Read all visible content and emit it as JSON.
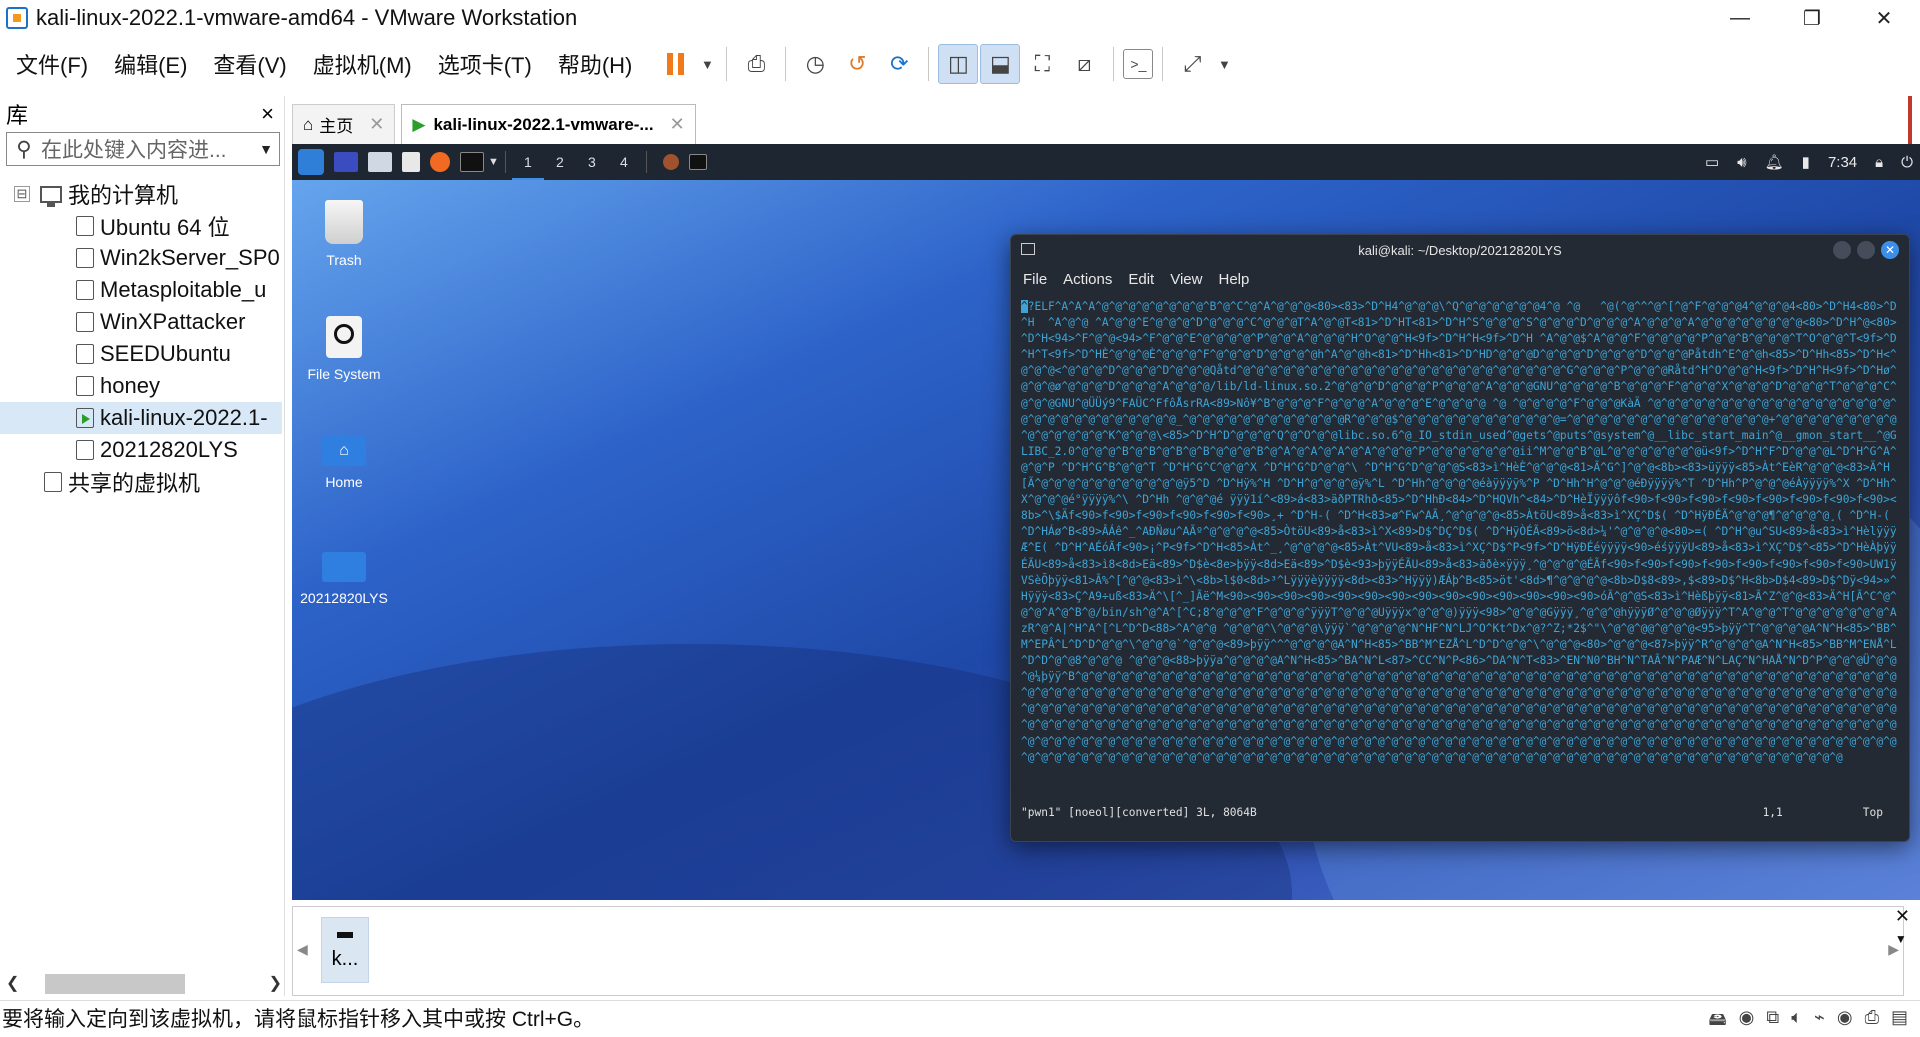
{
  "window": {
    "title": "kali-linux-2022.1-vmware-amd64 - VMware Workstation",
    "minimize": "—",
    "maximize": "❐",
    "close": "✕"
  },
  "menus": [
    "文件(F)",
    "编辑(E)",
    "查看(V)",
    "虚拟机(M)",
    "选项卡(T)",
    "帮助(H)"
  ],
  "library": {
    "title": "库",
    "close": "×",
    "search_placeholder": "在此处键入内容进...",
    "root": "我的计算机",
    "root_toggle": "⊟",
    "vms": [
      "Ubuntu 64 位",
      "Win2kServer_SP0",
      "Metasploitable_u",
      "WinXPattacker",
      "SEEDUbuntu",
      "honey",
      "kali-linux-2022.1-",
      "20212820LYS"
    ],
    "selected_vm": "kali-linux-2022.1-",
    "shared": "共享的虚拟机"
  },
  "tabs": [
    {
      "label": "主页",
      "close": "✕"
    },
    {
      "label": "kali-linux-2022.1-vmware-...",
      "close": "✕"
    }
  ],
  "guest": {
    "workspaces": [
      "1",
      "2",
      "3",
      "4"
    ],
    "active_workspace": "1",
    "clock": "7:34",
    "desktop_icons": [
      "Trash",
      "File System",
      "Home",
      "20212820LYS"
    ]
  },
  "terminal": {
    "title": "kali@kali: ~/Desktop/20212820LYS",
    "menu": [
      "File",
      "Actions",
      "Edit",
      "View",
      "Help"
    ],
    "cursor_char": "^",
    "content": "?ELF^A^A^A^@^@^@^@^@^@^@^@^B^@^C^@^A^@^@^@<80><83>^D^H4^@^@^@\\^Q^@^@^@^@^@^@4^@ ^@   ^@(^@^^^@^[^@^F^@^@^@4^@^@^@4<80>^D^H4<80>^D^H  ^A^@^@ ^A^@^@^E^@^@^@^D^@^@^@^C^@^@^@T^A^@^@T<81>^D^HT<81>^D^H^S^@^@^@^S^@^@^@^D^@^@^@^A^@^@^@^A^@^@^@^@^@^@^@^@<80>^D^H^@<80>^D^H<94>^F^@^@<94>^F^@^@^E^@^@^@^@^P^@^@^A^@^@^@^H^O^@^@^H<9f>^D^H^H<9f>^D^H ^A^@^@$^A^@^@^F^@^@^@^@^P^@^@^B^@^@^@^T^O^@^@^T<9f>^D^H^T<9f>^D^HÈ^@^@^@È^@^@^@^F^@^@^@^D^@^@^@^@h^A^@^@h<81>^D^Hh<81>^D^HD^@^@^@D^@^@^@^D^@^@^@^D^@^@^@Påtdh^E^@^@h<85>^D^Hh<85>^D^H<^@^@^@<^@^@^@^D^@^@^@^D^@^@^@Qåtd^@^@^@^@^@^@^@^@^@^@^@^@^@^@^@^@^@^@^@^@^@^@^@^@^G^@^@^@^P^@^@^@Råtd^H^O^@^@^H<9f>^D^H^H<9f>^D^Hø^@^@^@ø^@^@^@^D^@^@^@^A^@^@^@/lib/ld-linux.so.2^@^@^@^D^@^@^@^P^@^@^@^A^@^@^@GNU^@^@^@^@^B^@^@^@^F^@^@^@^X^@^@^@^D^@^@^@^T^@^@^@^C^@^@^@GNU^@ÜÜý9^FAÜC^FfôÅsrRA<89>Nô¥^B^@^@^@^F^@^@^@^A^@^@^@^E^@^@^@^@ ^@ ^@^@^@^@^F^@^@^@KàÄ ^@^@^@^@^@^@^@^@^@^@^@^@^@^@^@^@^@^@^@^@^@^@^@^@^@^@^@^@^@^@_^@^@^@^@^@^@^@^@^@^@^@^@R^@^@^@$^@^@^@^@^@^@^@^@^@^@^@^@=^@^@^@^@^@^@^@^@^@^@^@^@^@^@^@+^@^@^@^@^@^@^@^@^@^@^@^@^@^@^@^K^@^@^@\\<85>^D^H^D^@^@^@^Q^@^O^@^@libc.so.6^@_IO_stdin_used^@gets^@puts^@system^@__libc_start_main^@__gmon_start__^@GLIBC_2.0^@^@^@^B^@^B^@^B^@^B^@^@^@^B^@^A^@^A^@^A^@^A^@^@^@^P^@^@^@^@^@^@^@ii^M^@^@^B^@L^@^@^@^@^@^@^@ü<9f>^D^H^F^D^@^@^@L^D^H^G^A^@^@^P ^D^H^G^B^@^@^T ^D^H^G^C^@^@^X ^D^H^G^D^@^@^\\ ^D^H^G^D^@^@^@S<83>ì^HèÈ^@^@^@<81>Ã^G^]^@^@<8b><83>üÿÿÿ<85>Àt^EèR^@^@^@<83>Ä^H[Ã^@^@^@^@^@^@^@^@^@^@^@ÿ5^D ^D^Hÿ%^H ^D^H^@^@^@^@ÿ%^L ^D^Hh^@^@^@^@éàÿÿÿÿ%^P ^D^Hh^H^@^@^@éÐÿÿÿÿ%^T ^D^Hh^P^@^@^@éÀÿÿÿÿ%^X ^D^Hh^X^@^@^@é°ÿÿÿÿ%^\\ ^D^Hh ^@^@^@é ÿÿÿ1í^<89>á<83>äðPTRhð<85>^D^HhÐ<84>^D^HQVh^<84>^D^HèÏÿÿÿôf<90>f<90>f<90>f<90>f<90>f<90>f<90>f<90><8b>^\\$Äf<90>f<90>f<90>f<90>f<90>f<90>¸+ ^D^H-( ^D^H<83>ø^Fw^AÃ¸^@^@^@^@<85>ÀtöU<89>å<83>ì^XÇ^D$( ^D^HÿÐÉÃ^@^@^@¶^@^@^@^@¸( ^D^H-( ^D^HÁø^B<89>ÂÁê^_^AÐÑøu^AÃº^@^@^@^@<85>ÒtöU<89>å<83>ì^X<89>D$^DÇ^D$( ^D^HÿÒÉÃ<89>ö<8d>¼'^@^@^@^@<80>=( ^D^H^@u^SU<89>å<83>ì^HèlÿÿÿÆ^E( ^D^H^AÉóÃf<90>¡^P<9f>^D^H<85>Àt^_¸^@^@^@^@<85>Àt^VU<89>å<83>ì^XÇ^D$^P<9f>^D^HÿÐÉéÿÿÿÿ<90>éśÿÿÿU<89>å<83>ì^XÇ^D$^<85>^D^HèÀþÿÿÉÃU<89>å<83>ì8<8d>Eä<89>^D$è<8e>þÿÿ<8d>Eä<89>^D$è<93>þÿÿÉÃU<89>å<83>äðè×ÿÿÿ¸^@^@^@^@ÉÃf<90>f<90>f<90>f<90>f<90>f<90>f<90>f<90>UW1ÿVSèÕþÿÿ<81>Ã%^[^@^@<83>ì^\\<8b>l$0<8d>³^Lÿÿÿèÿÿÿÿ<8d><83>^Hÿÿÿ)ÆÁþ^B<85>öt'<8d>¶^@^@^@^@<8b>D$8<89>,$<89>D$^H<8b>D$4<89>D$^Dÿ<94>»^Hÿÿÿ<83>Ç^A9÷uß<83>Ä^\\[^_]Ãë^M<90><90><90><90><90><90><90><90><90><90><90><90><90><90>óÃ^@^@S<83>ì^Hèßþÿÿ<81>Ã^Z^@^@<83>Ä^H[Ã^C^@^@^@^A^@^B^@/bin/sh^@^A^[^C;8^@^@^@^F^@^@^@^ÿÿÿT^@^@^@Uÿÿÿx^@^@^@)ÿÿÿ<98>^@^@^@Gÿÿÿ¸^@^@^@hÿÿÿØ^@^@^@Øÿÿÿ^T^A^@^@^T^@^@^@^@^@^@^@^AzR^@^A|^H^A^[^L^D^D<88>^A^@^@ ^@^@^@^\\^@^@^@\\ÿÿÿ`^@^@^@^@^N^HF^N^LJ^O^Kt^Dx^@?^Z;*2$^\"\\^@^@^@@^@^@^@<95>þÿÿ^T^@^@^@^@A^N^H<85>^BB^M^EPÂ^L^D^D^@^@^\\^@^@^@`^@^@^@<89>þÿÿ^^^@^@^@^@A^N^H<85>^BB^M^EZÅ^L^D^D^@^@^\\^@^@^@<80>^@^@^@<87>þÿÿ^R^@^@^@^@A^N^H<85>^BB^M^ENÅ^L^D^D^@^@8^@^@^@ ^@^@^@<88>þÿÿa^@^@^@^@A^N^H<85>^BA^N^L<87>^CC^N^P<86>^DA^N^T<83>^EN^N0^BH^N^TAÃ^N^PAÆ^N^LAÇ^N^HAÅ^N^D^P^@^@^@Ü^@^@^@¼þÿÿ^B^@^@^@^@^@^@^@^@^@^@^@^@^@^@^@^@^@^@^@^@^@^@^@^@^@^@^@^@^@^@^@^@^@^@^@^@^@^@^@^@^@^@^@^@^@^@^@^@^@^@^@^@^@^@^@^@^@^@^@^@^@^@^@^@^@^@^@^@^@^@^@^@^@^@^@^@^@^@^@^@^@^@^@^@^@^@^@^@^@^@^@^@^@^@^@^@^@^@^@^@^@^@^@^@^@^@^@^@^@^@^@^@^@^@^@^@^@^@^@^@^@^@^@^@^@^@^@^@^@^@^@^@^@^@^@^@^@^@^@^@^@^@^@^@^@^@^@^@^@^@^@^@^@^@^@^@^@^@^@^@^@^@^@^@^@^@^@^@^@^@^@^@^@^@^@^@^@^@^@^@^@^@^@^@^@^@^@^@^@^@^@^@^@^@^@^@^@^@^@^@^@^@^@^@^@^@^@^@^@^@^@^@^@^@^@^@^@^@^@^@^@^@^@^@^@^@^@^@^@^@^@^@^@^@^@^@^@^@^@^@^@^@^@^@^@^@^@^@^@^@^@^@^@^@^@^@^@^@^@^@^@^@^@^@^@^@^@^@^@^@^@^@^@^@^@^@^@^@^@^@^@^@^@^@^@^@^@^@^@^@^@^@^@^@^@^@^@^@^@^@^@^@^@^@^@^@^@^@^@^@^@^@^@^@^@^@^@^@^@^@^@^@^@^@^@^@^@^@^@^@^@^@^@^@^@^@^@^@^@^@^@^@^@^@^@^@^@^@^@^@^@^@^@^@^@^@^@^@^@^@^@^@^@^@^@^@^@^@^@^@^@^@^@^@^@^@^@^@^@^@^@^@",
    "status_left": "\"pwn1\" [noeol][converted] 3L, 8064B",
    "status_pos": "1,1",
    "status_scroll": "Top"
  },
  "thumbnail": {
    "label": "k..."
  },
  "statusbar": {
    "message": "要将输入定向到该虚拟机，请将鼠标指针移入其中或按 Ctrl+G。"
  }
}
